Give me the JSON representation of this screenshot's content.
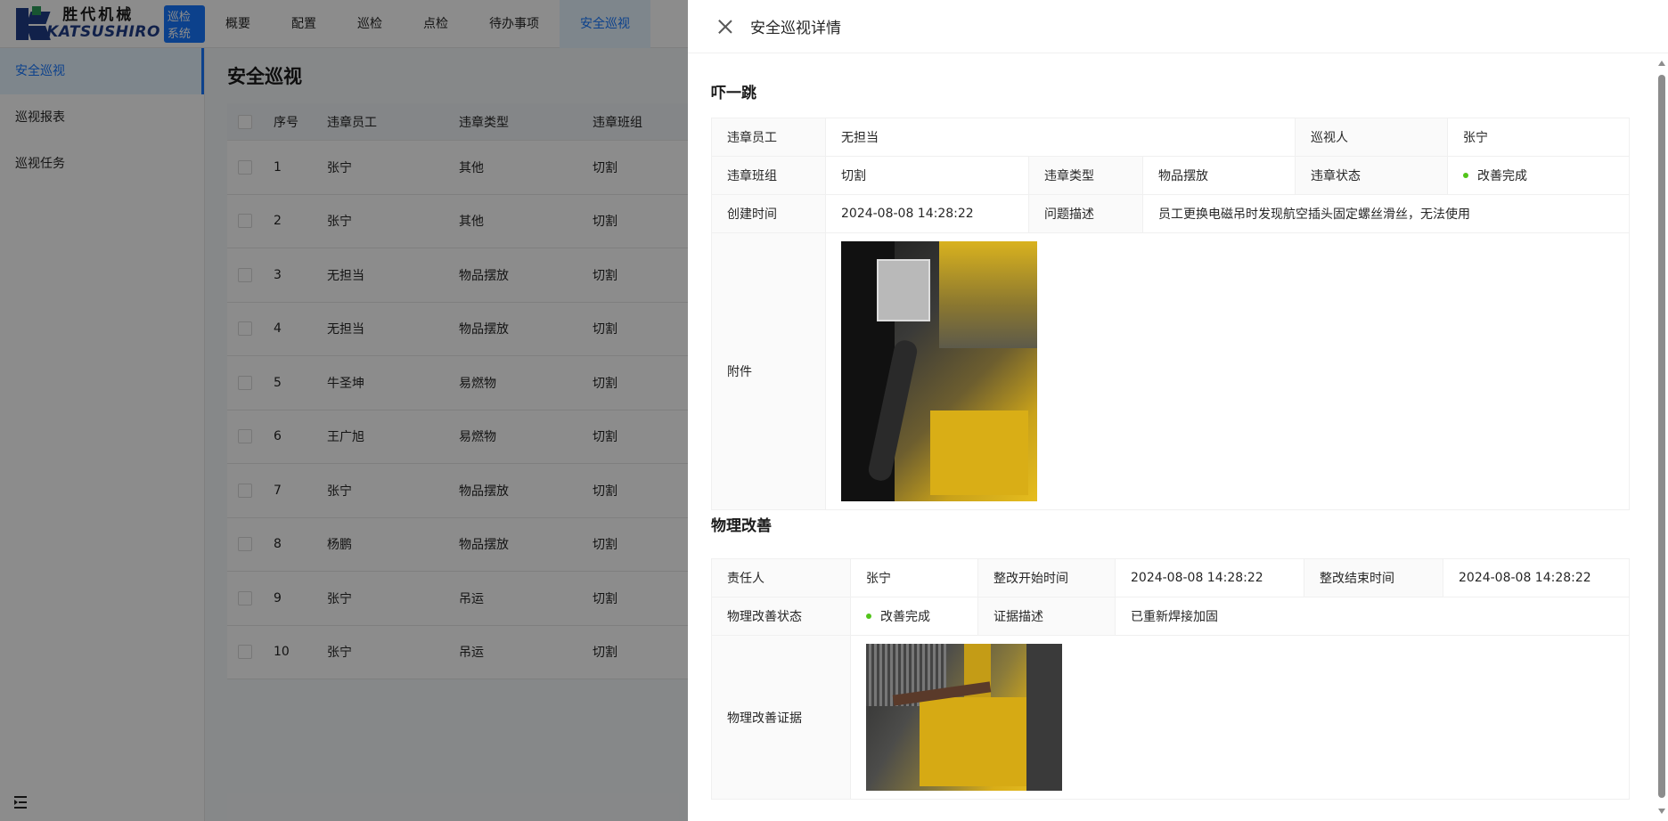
{
  "brand": {
    "name_cn": "胜代机械",
    "name_en": "KATSUSHIRO",
    "system_badge": "巡检系统"
  },
  "topnav": {
    "items": [
      {
        "label": "概要"
      },
      {
        "label": "配置"
      },
      {
        "label": "巡检"
      },
      {
        "label": "点检"
      },
      {
        "label": "待办事项"
      },
      {
        "label": "安全巡视"
      }
    ],
    "active": "安全巡视"
  },
  "sidebar": {
    "items": [
      {
        "label": "安全巡视"
      },
      {
        "label": "巡视报表"
      },
      {
        "label": "巡视任务"
      }
    ],
    "active": "安全巡视"
  },
  "main": {
    "title": "安全巡视",
    "table": {
      "columns": [
        "序号",
        "违章员工",
        "违章类型",
        "违章班组"
      ],
      "rows": [
        {
          "no": "1",
          "employee": "张宁",
          "type": "其他",
          "team": "切割"
        },
        {
          "no": "2",
          "employee": "张宁",
          "type": "其他",
          "team": "切割"
        },
        {
          "no": "3",
          "employee": "无担当",
          "type": "物品摆放",
          "team": "切割"
        },
        {
          "no": "4",
          "employee": "无担当",
          "type": "物品摆放",
          "team": "切割"
        },
        {
          "no": "5",
          "employee": "牛圣坤",
          "type": "易燃物",
          "team": "切割"
        },
        {
          "no": "6",
          "employee": "王广旭",
          "type": "易燃物",
          "team": "切割"
        },
        {
          "no": "7",
          "employee": "张宁",
          "type": "物品摆放",
          "team": "切割"
        },
        {
          "no": "8",
          "employee": "杨鹏",
          "type": "物品摆放",
          "team": "切割"
        },
        {
          "no": "9",
          "employee": "张宁",
          "type": "吊运",
          "team": "切割"
        },
        {
          "no": "10",
          "employee": "张宁",
          "type": "吊运",
          "team": "切割"
        }
      ]
    }
  },
  "drawer": {
    "title": "安全巡视详情",
    "section1": {
      "title": "吓一跳",
      "fields": {
        "employee_label": "违章员工",
        "employee": "无担当",
        "inspector_label": "巡视人",
        "inspector": "张宁",
        "team_label": "违章班组",
        "team": "切割",
        "type_label": "违章类型",
        "type": "物品摆放",
        "status_label": "违章状态",
        "status": "改善完成",
        "created_label": "创建时间",
        "created": "2024-08-08 14:28:22",
        "desc_label": "问题描述",
        "desc": "员工更换电磁吊时发现航空插头固定螺丝滑丝，无法使用",
        "attachment_label": "附件"
      }
    },
    "section2": {
      "title": "物理改善",
      "fields": {
        "owner_label": "责任人",
        "owner": "张宁",
        "start_label": "整改开始时间",
        "start": "2024-08-08 14:28:22",
        "end_label": "整改结束时间",
        "end": "2024-08-08 14:28:22",
        "status_label": "物理改善状态",
        "status": "改善完成",
        "evidence_desc_label": "证据描述",
        "evidence_desc": "已重新焊接加固",
        "evidence_label": "物理改善证据"
      }
    }
  },
  "colors": {
    "accent": "#1677ff",
    "status_dot": "#52c41a"
  }
}
